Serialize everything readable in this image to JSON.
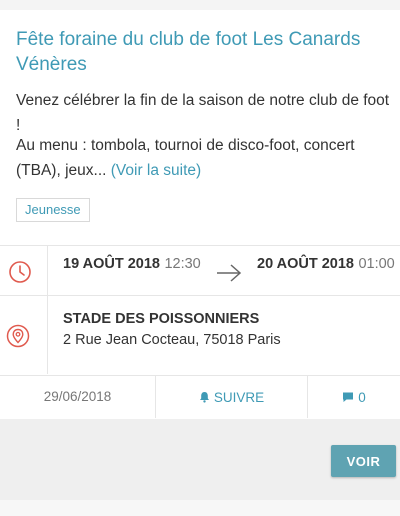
{
  "event": {
    "title": "Fête foraine du club de foot Les Canards Vénères",
    "intro": "Venez célébrer la fin de la saison de notre club de foot !",
    "description": "Au menu : tombola, tournoi de disco-foot, concert (TBA), jeux...",
    "read_more": "(Voir la suite)",
    "tag": "Jeunesse"
  },
  "dates": {
    "start_date": "19 AOÛT 2018",
    "start_time": "12:30",
    "end_date": "20 AOÛT 2018",
    "end_time": "01:00",
    "clock_icon": "clock-icon",
    "arrow_icon": "arrow-right-icon"
  },
  "location": {
    "name": "STADE DES POISSONNIERS",
    "address": "2 Rue Jean Cocteau, 75018 Paris",
    "icon": "map-pin-icon"
  },
  "footer": {
    "published_date": "29/06/2018",
    "follow_label": "SUIVRE",
    "follow_icon": "bell-icon",
    "comments_count": "0",
    "comments_icon": "comment-icon"
  },
  "actions": {
    "voir_label": "VOIR"
  },
  "colors": {
    "accent": "#3f9ab5",
    "icon_red": "#e05a4e",
    "button": "#5fa3b2"
  }
}
